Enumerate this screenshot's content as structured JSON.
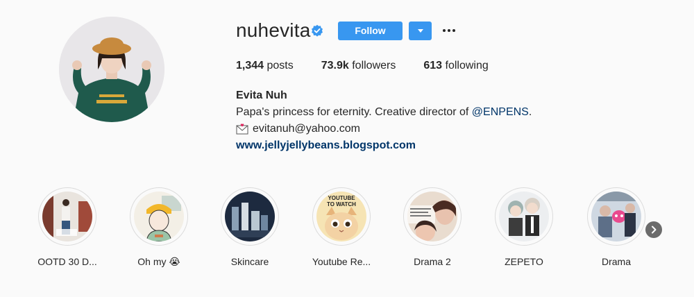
{
  "profile": {
    "username": "nuhevita",
    "follow_label": "Follow",
    "stats": {
      "posts_count": "1,344",
      "posts_label": " posts",
      "followers_count": "73.9k",
      "followers_label": " followers",
      "following_count": "613",
      "following_label": " following"
    },
    "bio": {
      "name": "Evita Nuh",
      "line1_text": "Papa's princess for eternity. Creative director of ",
      "mention": "@ENPENS",
      "line1_end": ".",
      "email": "evitanuh@yahoo.com",
      "website": "www.jellyjellybeans.blogspot.com"
    }
  },
  "highlights": [
    {
      "label": "OOTD 30 D..."
    },
    {
      "label": "Oh my 😭"
    },
    {
      "label": "Skincare"
    },
    {
      "label": "Youtube Re..."
    },
    {
      "label": "Drama 2"
    },
    {
      "label": "ZEPETO"
    },
    {
      "label": "Drama"
    }
  ],
  "highlight_cover_texts": {
    "youtube_line1": "YOUTUBE",
    "youtube_line2": "TO WATCH"
  },
  "colors": {
    "follow_blue": "#3897f0",
    "link_blue": "#003569",
    "verified_blue": "#3897f0"
  },
  "icons": {
    "verified": "verified-badge-icon",
    "dropdown": "caret-down-icon",
    "more": "more-horizontal-icon",
    "email": "envelope-icon",
    "next": "chevron-right-icon"
  }
}
